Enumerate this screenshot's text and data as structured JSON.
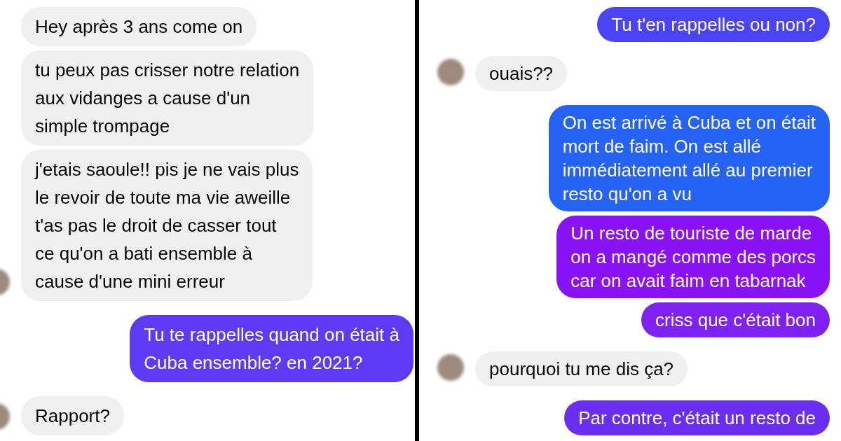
{
  "panels": [
    {
      "messages": [
        {
          "kind": "received",
          "text": "Hey après 3 ans come on",
          "avatar": false
        },
        {
          "kind": "received",
          "text": "tu peux pas crisser notre relation\naux vidanges a cause d'un\nsimple trompage",
          "avatar": false
        },
        {
          "kind": "received",
          "text": "j'etais saoule!! pis je ne vais plus\nle revoir de toute ma vie aweille\nt'as pas le droit de casser tout\nce qu'on a bati ensemble à\ncause d'une mini erreur",
          "avatar": true
        },
        {
          "kind": "sent",
          "text": "Tu te rappelles quand on était à\nCuba ensemble? en 2021?",
          "color": "#5b3cf4"
        },
        {
          "kind": "received",
          "text": "Rapport?",
          "avatar": true
        }
      ]
    },
    {
      "messages": [
        {
          "kind": "sent",
          "text": "Tu t'en rappelles ou non?",
          "color": "#4b44f5"
        },
        {
          "kind": "received",
          "text": "ouais??",
          "avatar": true
        },
        {
          "kind": "sent",
          "text": "On est arrivé à Cuba et on était\nmort de faim. On est allé\nimmédiatement allé au premier\nresto qu'on a vu",
          "color": "#2563f6"
        },
        {
          "kind": "sent",
          "text": "Un resto de touriste de marde\non a mangé comme des porcs\ncar on avait faim en tabarnak",
          "color": "#8a12f6"
        },
        {
          "kind": "sent",
          "text": "criss que c'était bon",
          "color": "#7d22f3"
        },
        {
          "kind": "received",
          "text": "pourquoi tu me dis ça?",
          "avatar": true
        },
        {
          "kind": "sent",
          "text": "Par contre, c'était un resto de",
          "color": "#6a2ef2"
        }
      ]
    }
  ]
}
